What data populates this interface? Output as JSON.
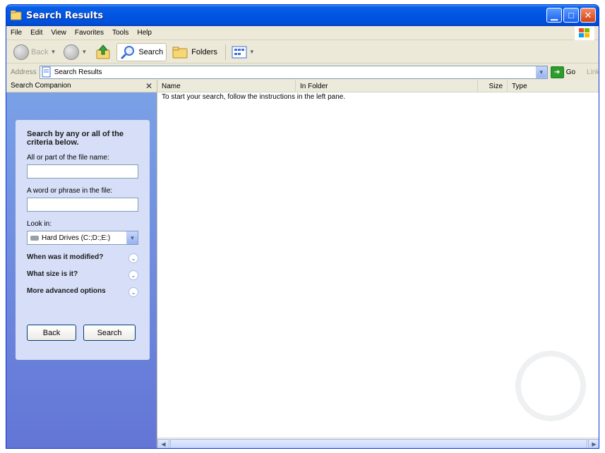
{
  "window": {
    "title": "Search Results"
  },
  "menu": {
    "items": [
      "File",
      "Edit",
      "View",
      "Favorites",
      "Tools",
      "Help"
    ]
  },
  "toolbar": {
    "back_label": "Back",
    "search_label": "Search",
    "folders_label": "Folders"
  },
  "address": {
    "label": "Address",
    "value": "Search Results",
    "go_label": "Go",
    "links_label": "Links",
    "links_chevron": "»"
  },
  "search_companion": {
    "header": "Search Companion",
    "close_glyph": "✕",
    "title": "Search by any or all of the criteria below.",
    "filename_label": "All or part of the file name:",
    "phrase_label": "A word or phrase in the file:",
    "lookin_label": "Look in:",
    "lookin_value": "Hard Drives (C:;D:;E:)",
    "modified_label": "When was it modified?",
    "size_label": "What size is it?",
    "advanced_label": "More advanced options",
    "back_button": "Back",
    "search_button": "Search"
  },
  "results": {
    "columns": [
      "Name",
      "In Folder",
      "Size",
      "Type"
    ],
    "instruction": "To start your search, follow the instructions in the left pane."
  },
  "colors": {
    "titlebar": "#0054e3",
    "pane_gradient_top": "#7ba2e7",
    "pane_gradient_bottom": "#6375d6",
    "card_bg": "#d6dff7",
    "chrome_bg": "#ece9d8"
  },
  "icons": [
    "folder-search-icon",
    "minimize-icon",
    "maximize-icon",
    "close-icon",
    "windows-logo-icon",
    "back-arrow-icon",
    "forward-arrow-icon",
    "up-folder-icon",
    "search-magnifier-icon",
    "folders-icon",
    "views-icon",
    "address-page-icon",
    "go-arrow-icon",
    "drive-icon",
    "chevron-down-icon"
  ]
}
